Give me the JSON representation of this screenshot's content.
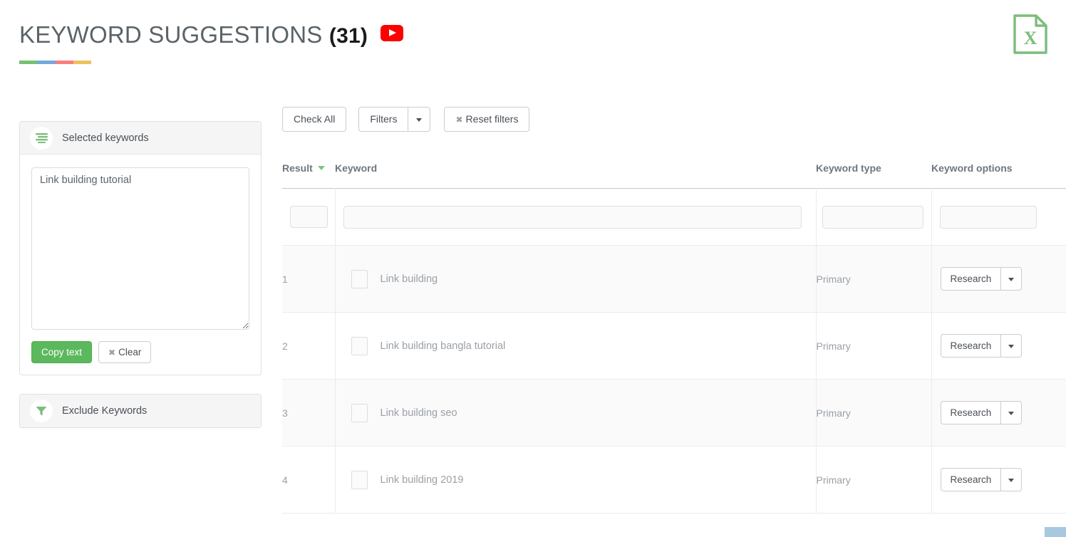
{
  "header": {
    "title": "KEYWORD SUGGESTIONS",
    "count": "(31)",
    "source_icon": "youtube-icon",
    "accent_bar_colors": [
      "#77c172",
      "#74a9dd",
      "#f98080",
      "#eec160"
    ],
    "export_icon": "excel-file-icon",
    "export_icon_color": "#7cbd7c",
    "export_letter": "X"
  },
  "sidebar": {
    "selected_keywords_panel": {
      "icon": "list-lines-icon",
      "title": "Selected keywords",
      "textarea_value": "Link building tutorial",
      "textarea_placeholder": "",
      "copy_label": "Copy text",
      "clear_label": "Clear",
      "clear_icon": "x-mark-icon"
    },
    "exclude_panel": {
      "icon": "funnel-filter-icon",
      "title": "Exclude Keywords"
    }
  },
  "toolbar": {
    "check_all_label": "Check All",
    "filters_label": "Filters",
    "filters_caret_icon": "caret-down-icon",
    "reset_filters_label": "Reset filters",
    "reset_icon": "x-mark-icon"
  },
  "table": {
    "columns": {
      "result": "Result",
      "keyword": "Keyword",
      "keyword_type": "Keyword type",
      "keyword_options": "Keyword options"
    },
    "sort_column": "Result",
    "sort_icon": "chevron-down-icon",
    "sort_icon_color": "#7fc57f",
    "filter_row": {
      "check_all_box": "",
      "keyword_filter_value": "",
      "keyword_filter_placeholder": "",
      "type_filter_value": "",
      "type_filter_placeholder": "",
      "options_filter_value": "",
      "options_filter_placeholder": ""
    },
    "action_label": "Research",
    "action_caret_icon": "caret-down-icon",
    "rows": [
      {
        "index": "1",
        "keyword": "Link building",
        "type": "Primary",
        "action": "Research",
        "checked": false
      },
      {
        "index": "2",
        "keyword": "Link building bangla tutorial",
        "type": "Primary",
        "action": "Research",
        "checked": false
      },
      {
        "index": "3",
        "keyword": "Link building seo",
        "type": "Primary",
        "action": "Research",
        "checked": false
      },
      {
        "index": "4",
        "keyword": "Link building 2019",
        "type": "Primary",
        "action": "Research",
        "checked": false
      }
    ]
  },
  "scrollbar": {
    "orientation": "horizontal",
    "thumb_color": "#a8c8e0"
  }
}
